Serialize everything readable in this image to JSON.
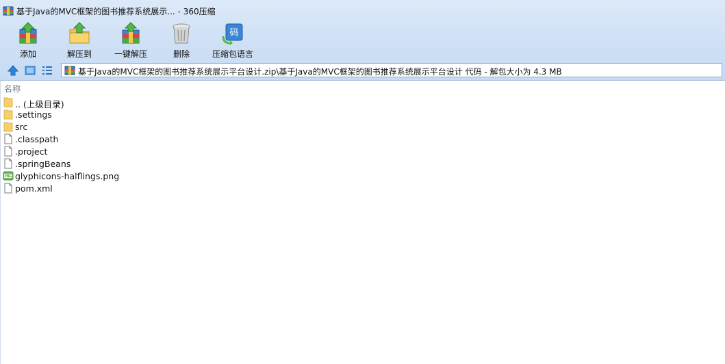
{
  "window": {
    "title": "基于Java的MVC框架的图书推荐系统展示... - 360压缩"
  },
  "toolbar": {
    "buttons": [
      {
        "label": "添加",
        "icon": "add-archive-icon"
      },
      {
        "label": "解压到",
        "icon": "extract-to-icon"
      },
      {
        "label": "一键解压",
        "icon": "one-click-extract-icon"
      },
      {
        "label": "删除",
        "icon": "trash-icon"
      },
      {
        "label": "压缩包语言",
        "icon": "archive-language-icon"
      }
    ]
  },
  "address": {
    "path": "基于Java的MVC框架的图书推荐系统展示平台设计.zip\\基于Java的MVC框架的图书推荐系统展示平台设计 代码 - 解包大小为 4.3 MB"
  },
  "list": {
    "column_name": "名称",
    "items": [
      {
        "name": ".. (上级目录)",
        "type": "folder"
      },
      {
        "name": ".settings",
        "type": "folder"
      },
      {
        "name": "src",
        "type": "folder"
      },
      {
        "name": ".classpath",
        "type": "file"
      },
      {
        "name": ".project",
        "type": "file"
      },
      {
        "name": ".springBeans",
        "type": "file"
      },
      {
        "name": "glyphicons-halflings.png",
        "type": "png"
      },
      {
        "name": "pom.xml",
        "type": "file"
      }
    ]
  },
  "colors": {
    "chrome_top": "#dce9f8",
    "chrome_bottom": "#c6dbf3",
    "folder": "#f5cf6a",
    "accent": "#1e72c8"
  }
}
